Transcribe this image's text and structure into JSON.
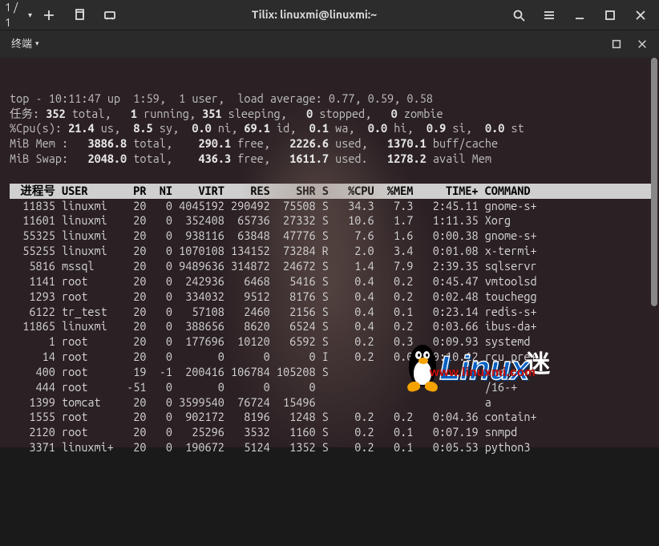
{
  "titlebar": {
    "counter": "1 / 1",
    "title": "Tilix: linuxmi@linuxmi:~"
  },
  "tab": {
    "label": "终端"
  },
  "summary": {
    "line1_a": "top - ",
    "time": "10:11:47",
    "line1_b": " up  1:59,  1 user,  load average: ",
    "load": "0.77, 0.59, 0.58",
    "tasks_label": "任务: ",
    "tasks_total": "352",
    "tasks_running": "1",
    "tasks_sleeping": "351",
    "tasks_stopped": "0",
    "tasks_zombie": "0",
    "cpu_label": "%Cpu(s): ",
    "cpu_us": "21.4",
    "cpu_sy": "8.5",
    "cpu_ni": "0.0",
    "cpu_id": "69.1",
    "cpu_wa": "0.1",
    "cpu_hi": "0.0",
    "cpu_si": "0.9",
    "cpu_st": "0.0",
    "mem_label": "MiB Mem : ",
    "mem_total": "3886.8",
    "mem_free": "290.1",
    "mem_used": "2226.6",
    "mem_buff": "1370.1",
    "swap_label": "MiB Swap: ",
    "swap_total": "2048.0",
    "swap_free": "436.3",
    "swap_used": "1611.7",
    "swap_avail": "1278.2"
  },
  "headers": {
    "pid": " 进程号",
    "user": "USER",
    "pr": "PR",
    "ni": "NI",
    "virt": "VIRT",
    "res": "RES",
    "shr": "SHR",
    "s": "S",
    "cpu": "%CPU",
    "mem": "%MEM",
    "time": "TIME+",
    "cmd": "COMMAND "
  },
  "rows": [
    {
      "pid": "11835",
      "user": "linuxmi",
      "pr": "20",
      "ni": "0",
      "virt": "4045192",
      "res": "290492",
      "shr": "75508",
      "s": "S",
      "cpu": "34.3",
      "mem": "7.3",
      "time": "2:45.11",
      "cmd": "gnome-s+"
    },
    {
      "pid": "11601",
      "user": "linuxmi",
      "pr": "20",
      "ni": "0",
      "virt": "352408",
      "res": "65736",
      "shr": "27332",
      "s": "S",
      "cpu": "10.6",
      "mem": "1.7",
      "time": "1:11.35",
      "cmd": "Xorg"
    },
    {
      "pid": "55325",
      "user": "linuxmi",
      "pr": "20",
      "ni": "0",
      "virt": "938116",
      "res": "63848",
      "shr": "47776",
      "s": "S",
      "cpu": "7.6",
      "mem": "1.6",
      "time": "0:00.38",
      "cmd": "gnome-s+"
    },
    {
      "pid": "55255",
      "user": "linuxmi",
      "pr": "20",
      "ni": "0",
      "virt": "1070108",
      "res": "134152",
      "shr": "73284",
      "s": "R",
      "cpu": "2.0",
      "mem": "3.4",
      "time": "0:01.08",
      "cmd": "x-termi+"
    },
    {
      "pid": "5816",
      "user": "mssql",
      "pr": "20",
      "ni": "0",
      "virt": "9489636",
      "res": "314872",
      "shr": "24672",
      "s": "S",
      "cpu": "1.4",
      "mem": "7.9",
      "time": "2:39.35",
      "cmd": "sqlservr"
    },
    {
      "pid": "1141",
      "user": "root",
      "pr": "20",
      "ni": "0",
      "virt": "242936",
      "res": "6468",
      "shr": "5416",
      "s": "S",
      "cpu": "0.4",
      "mem": "0.2",
      "time": "0:45.47",
      "cmd": "vmtoolsd"
    },
    {
      "pid": "1293",
      "user": "root",
      "pr": "20",
      "ni": "0",
      "virt": "334032",
      "res": "9512",
      "shr": "8176",
      "s": "S",
      "cpu": "0.4",
      "mem": "0.2",
      "time": "0:02.48",
      "cmd": "touchegg"
    },
    {
      "pid": "6122",
      "user": "tr_test",
      "pr": "20",
      "ni": "0",
      "virt": "57108",
      "res": "2460",
      "shr": "2156",
      "s": "S",
      "cpu": "0.4",
      "mem": "0.1",
      "time": "0:23.14",
      "cmd": "redis-s+"
    },
    {
      "pid": "11865",
      "user": "linuxmi",
      "pr": "20",
      "ni": "0",
      "virt": "388656",
      "res": "8620",
      "shr": "6524",
      "s": "S",
      "cpu": "0.4",
      "mem": "0.2",
      "time": "0:03.66",
      "cmd": "ibus-da+"
    },
    {
      "pid": "1",
      "user": "root",
      "pr": "20",
      "ni": "0",
      "virt": "177696",
      "res": "10120",
      "shr": "6592",
      "s": "S",
      "cpu": "0.2",
      "mem": "0.3",
      "time": "0:09.93",
      "cmd": "systemd"
    },
    {
      "pid": "14",
      "user": "root",
      "pr": "20",
      "ni": "0",
      "virt": "0",
      "res": "0",
      "shr": "0",
      "s": "I",
      "cpu": "0.2",
      "mem": "0.0",
      "time": "0:10.12",
      "cmd": "rcu_pre+"
    },
    {
      "pid": "400",
      "user": "root",
      "pr": "19",
      "ni": "-1",
      "virt": "200416",
      "res": "106784",
      "shr": "105208",
      "s": "S",
      "cpu": "",
      "mem": "",
      "time": "",
      "cmd": "temd+"
    },
    {
      "pid": "444",
      "user": "root",
      "pr": "-51",
      "ni": "0",
      "virt": "0",
      "res": "0",
      "shr": "0",
      "s": "",
      "cpu": "",
      "mem": "",
      "time": "",
      "cmd": "/16-+"
    },
    {
      "pid": "1399",
      "user": "tomcat",
      "pr": "20",
      "ni": "0",
      "virt": "3599540",
      "res": "76724",
      "shr": "15496",
      "s": "",
      "cpu": "",
      "mem": "",
      "time": "",
      "cmd": "a"
    },
    {
      "pid": "1555",
      "user": "root",
      "pr": "20",
      "ni": "0",
      "virt": "902172",
      "res": "8196",
      "shr": "1248",
      "s": "S",
      "cpu": "0.2",
      "mem": "0.2",
      "time": "0:04.36",
      "cmd": "contain+"
    },
    {
      "pid": "2120",
      "user": "root",
      "pr": "20",
      "ni": "0",
      "virt": "25296",
      "res": "3532",
      "shr": "1160",
      "s": "S",
      "cpu": "0.2",
      "mem": "0.1",
      "time": "0:07.19",
      "cmd": "snmpd"
    },
    {
      "pid": "3371",
      "user": "linuxmi+",
      "pr": "20",
      "ni": "0",
      "virt": "190672",
      "res": "5124",
      "shr": "1352",
      "s": "S",
      "cpu": "0.2",
      "mem": "0.1",
      "time": "0:05.53",
      "cmd": "python3"
    }
  ],
  "watermark": {
    "brand": "Linux",
    "suffix": "迷",
    "url": "www.linuxmi.com"
  }
}
